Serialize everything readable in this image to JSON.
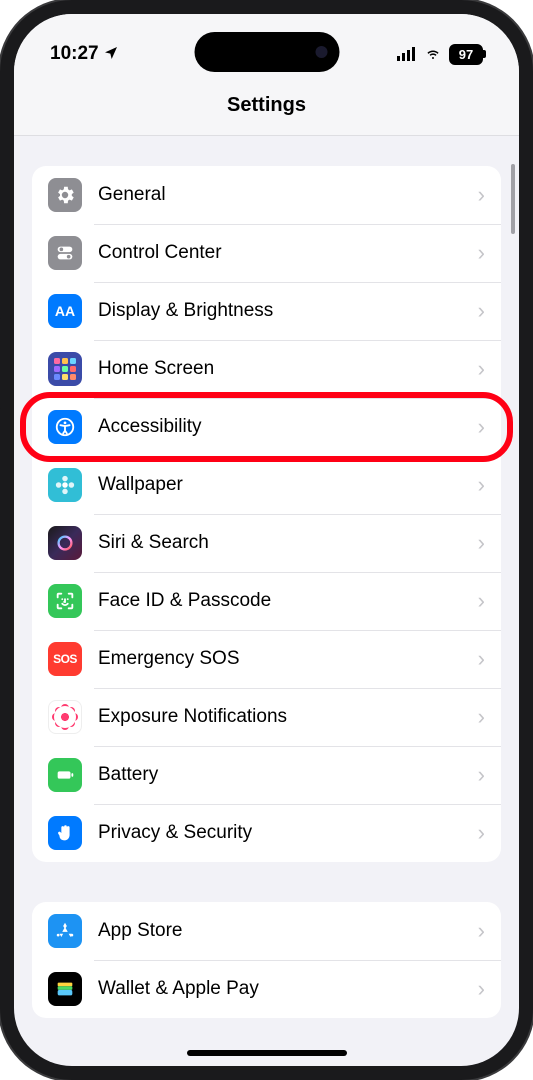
{
  "status": {
    "time": "10:27",
    "battery": "97"
  },
  "header": {
    "title": "Settings"
  },
  "groups": [
    {
      "items": [
        {
          "key": "general",
          "label": "General"
        },
        {
          "key": "control-center",
          "label": "Control Center"
        },
        {
          "key": "display-brightness",
          "label": "Display & Brightness"
        },
        {
          "key": "home-screen",
          "label": "Home Screen"
        },
        {
          "key": "accessibility",
          "label": "Accessibility",
          "highlighted": true
        },
        {
          "key": "wallpaper",
          "label": "Wallpaper"
        },
        {
          "key": "siri-search",
          "label": "Siri & Search"
        },
        {
          "key": "face-id-passcode",
          "label": "Face ID & Passcode"
        },
        {
          "key": "emergency-sos",
          "label": "Emergency SOS"
        },
        {
          "key": "exposure-notifications",
          "label": "Exposure Notifications"
        },
        {
          "key": "battery",
          "label": "Battery"
        },
        {
          "key": "privacy-security",
          "label": "Privacy & Security"
        }
      ]
    },
    {
      "items": [
        {
          "key": "app-store",
          "label": "App Store"
        },
        {
          "key": "wallet-apple-pay",
          "label": "Wallet & Apple Pay"
        }
      ]
    }
  ]
}
